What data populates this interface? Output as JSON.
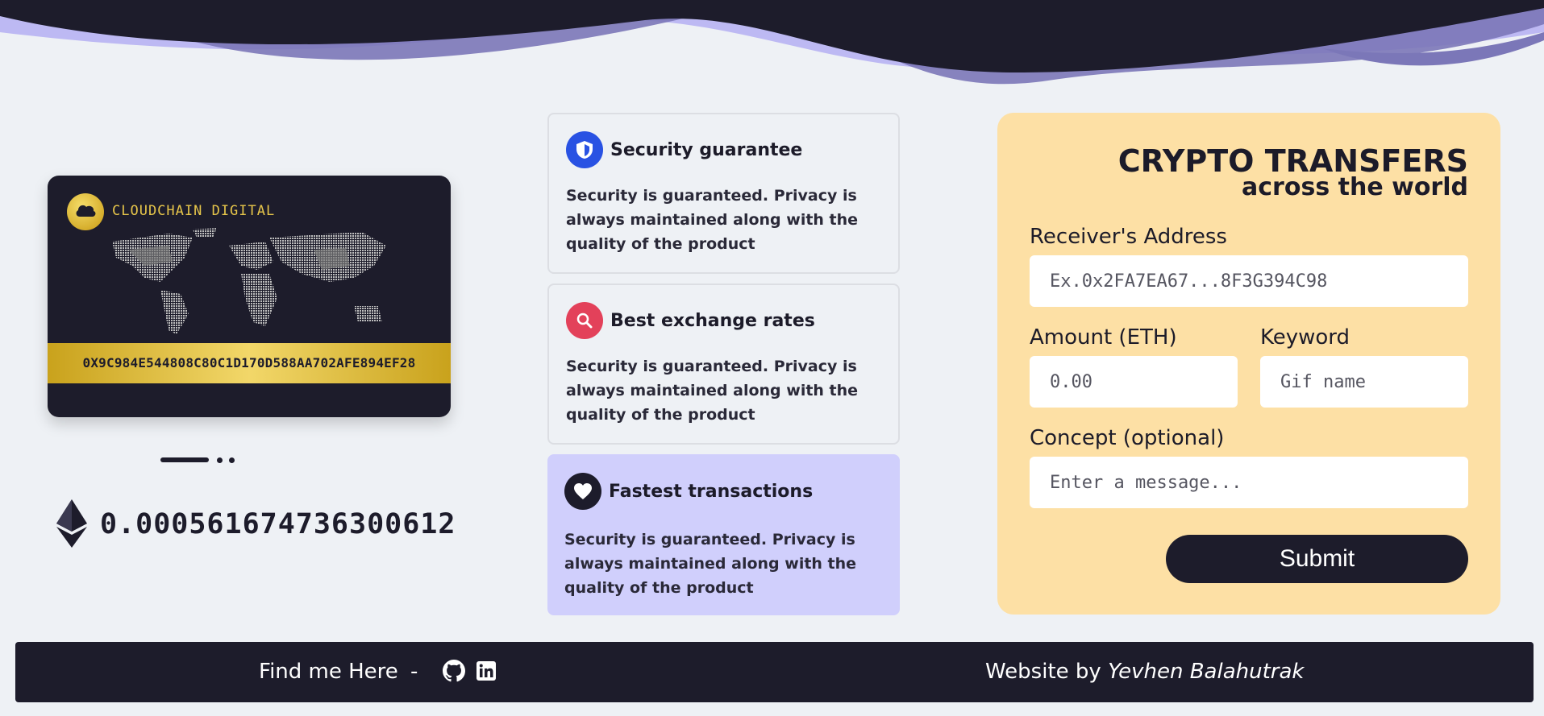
{
  "card": {
    "brand": "CLOUDCHAIN DIGITAL",
    "account_number": "0X9C984E544808C80C1D170D588AA702AFE894EF28",
    "logo_icon": "cloud-icon",
    "colors": {
      "card_bg": "#1d1c2b",
      "gold": "#e6c54a"
    }
  },
  "carousel": {
    "active_index": 0,
    "count": 3
  },
  "balance": {
    "icon": "ethereum-icon",
    "value": "0.000561674736300612"
  },
  "features": [
    {
      "icon": "shield-icon",
      "icon_color": "#2952e3",
      "title": "Security guarantee",
      "text": "Security is guaranteed. Privacy is always maintained along with the quality of the product"
    },
    {
      "icon": "search-icon",
      "icon_color": "#e3415a",
      "title": "Best exchange rates",
      "text": "Security is guaranteed. Privacy is always maintained along with the quality of the product"
    },
    {
      "icon": "heart-icon",
      "icon_color": "#1d1c2b",
      "title": "Fastest transactions",
      "text": "Security is guaranteed. Privacy is always maintained along with the quality of the product"
    }
  ],
  "transfer": {
    "title": "CRYPTO TRANSFERS",
    "subtitle": "across the world",
    "receiver_label": "Receiver's Address",
    "receiver_placeholder": "Ex.0x2FA7EA67...8F3G394C98",
    "amount_label": "Amount (ETH)",
    "amount_placeholder": "0.00",
    "keyword_label": "Keyword",
    "keyword_placeholder": "Gif name",
    "concept_label": "Concept (optional)",
    "concept_placeholder": "Enter a message...",
    "submit_label": "Submit",
    "panel_color": "#fde0a5"
  },
  "footer": {
    "find_label": "Find me Here",
    "separator": "-",
    "social_icons": [
      "github-icon",
      "linkedin-icon"
    ],
    "credit_prefix": "Website by",
    "author": "Yevhen Balahutrak"
  }
}
